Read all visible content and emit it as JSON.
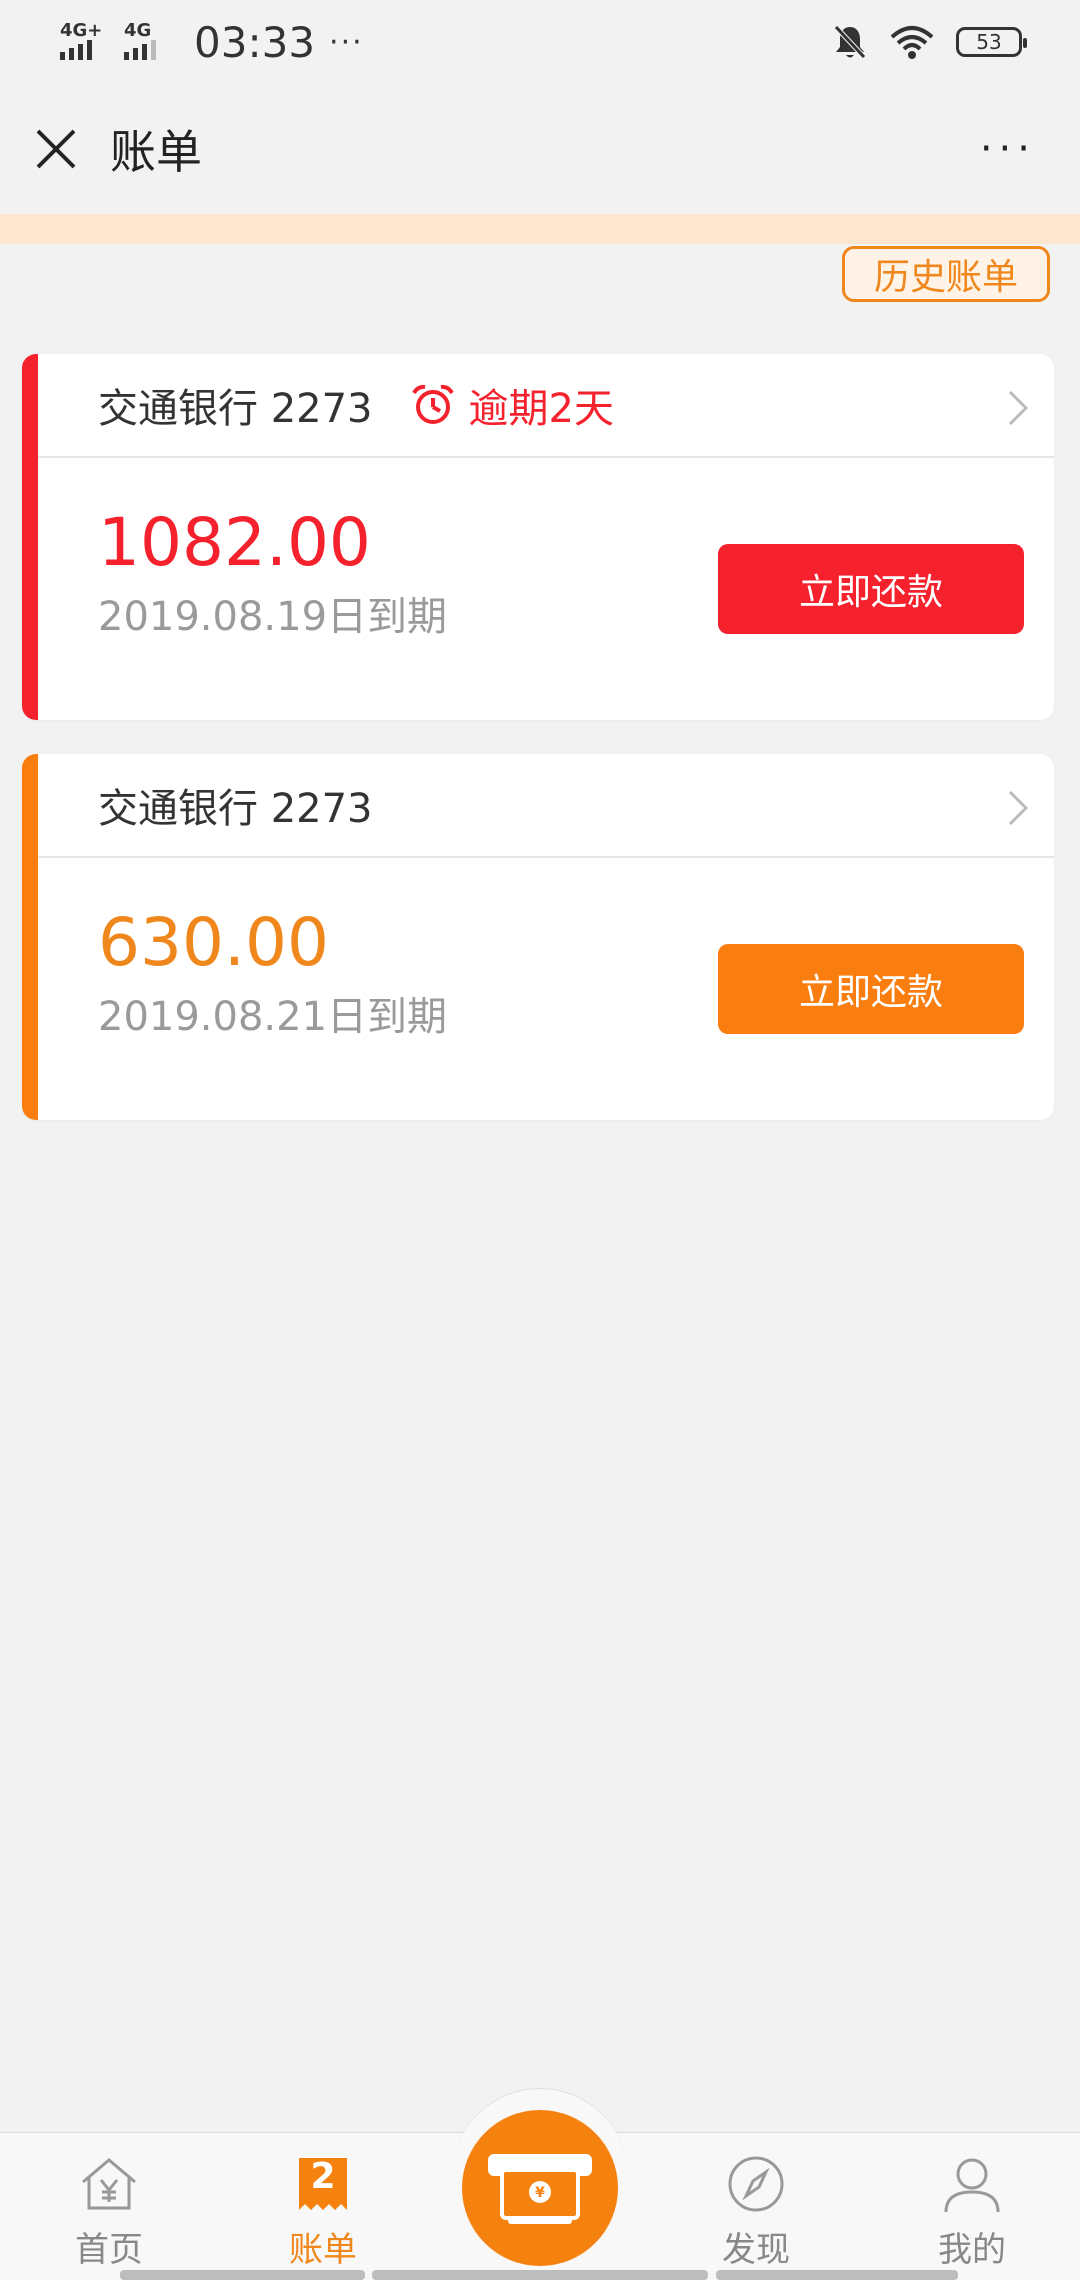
{
  "status_bar": {
    "network_1": "4G+",
    "network_2": "4G",
    "time": "03:33",
    "dots": "···",
    "battery": "53"
  },
  "nav": {
    "title": "账单",
    "more": "···"
  },
  "history_button": "历史账单",
  "bills": [
    {
      "bank": "交通银行 2273",
      "overdue": "逾期2天",
      "amount": "1082.00",
      "due": "2019.08.19日到期",
      "pay_label": "立即还款",
      "accent": "#f5222d"
    },
    {
      "bank": "交通银行 2273",
      "amount": "630.00",
      "due": "2019.08.21日到期",
      "pay_label": "立即还款",
      "accent": "#fa7d0f"
    }
  ],
  "tabs": {
    "home": "首页",
    "bills": "账单",
    "bills_badge": "2",
    "discover": "发现",
    "mine": "我的"
  },
  "colors": {
    "orange": "#f0871c",
    "red": "#f5222d"
  }
}
